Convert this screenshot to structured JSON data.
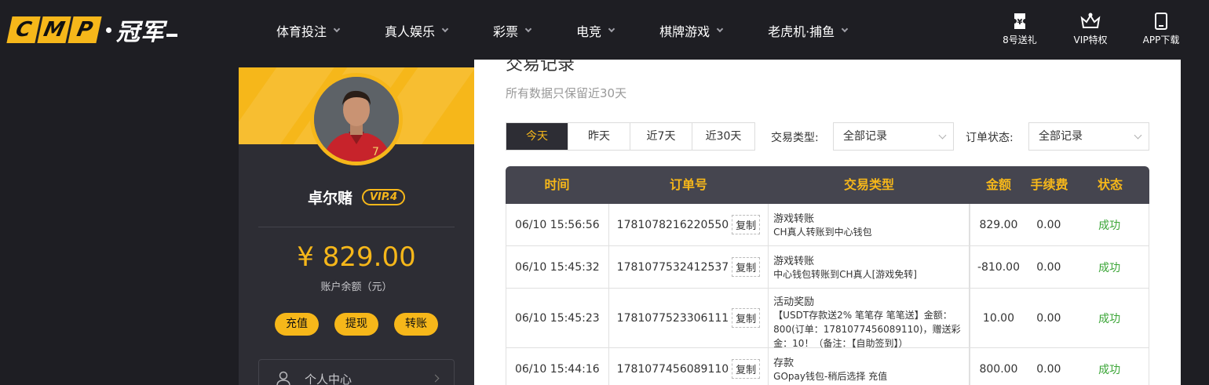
{
  "header": {
    "logo_letters": [
      "C",
      "M",
      "P"
    ],
    "logo_cn": "冠军",
    "nav": [
      {
        "label": "体育投注"
      },
      {
        "label": "真人娱乐"
      },
      {
        "label": "彩票"
      },
      {
        "label": "电竞"
      },
      {
        "label": "棋牌游戏"
      },
      {
        "label": "老虎机·捕鱼"
      }
    ],
    "tools": [
      {
        "label": "8号送礼",
        "icon": "gift-ticket-icon"
      },
      {
        "label": "VIP特权",
        "icon": "crown-icon"
      },
      {
        "label": "APP下载",
        "icon": "phone-icon"
      }
    ]
  },
  "sidebar": {
    "username": "卓尔赌",
    "vip": "VIP.4",
    "balance": "¥ 829.00",
    "balance_label": "账户余额（元）",
    "actions": [
      "充值",
      "提现",
      "转账"
    ],
    "menu": [
      {
        "label": "个人中心"
      }
    ]
  },
  "main": {
    "title": "交易记录",
    "note": "所有数据只保留近30天",
    "ranges": [
      "今天",
      "昨天",
      "近7天",
      "近30天"
    ],
    "active_range": "今天",
    "filters": {
      "type_label": "交易类型:",
      "type_value": "全部记录",
      "status_label": "订单状态:",
      "status_value": "全部记录"
    },
    "table": {
      "headers": [
        "时间",
        "订单号",
        "交易类型",
        "金额",
        "手续费",
        "状态"
      ],
      "copy_label": "复制",
      "rows": [
        {
          "time": "06/10 15:56:56",
          "order": "1781078216220550",
          "type": "游戏转账",
          "detail": "CH真人转账到中心钱包",
          "amount": "829.00",
          "fee": "0.00",
          "status": "成功"
        },
        {
          "time": "06/10 15:45:32",
          "order": "1781077532412537",
          "type": "游戏转账",
          "detail": "中心钱包转账到CH真人[游戏免转]",
          "amount": "-810.00",
          "fee": "0.00",
          "status": "成功"
        },
        {
          "time": "06/10 15:45:23",
          "order": "1781077523306111",
          "type": "活动奖励",
          "detail": "【USDT存款送2% 笔笔存 笔笔送】金额：800(订单：1781077456089110)，赠送彩金：10！（备注：【自助签到】）",
          "amount": "10.00",
          "fee": "0.00",
          "status": "成功"
        },
        {
          "time": "06/10 15:44:16",
          "order": "1781077456089110",
          "type": "存款",
          "detail": "GOpay钱包-稍后选择 充值",
          "amount": "800.00",
          "fee": "0.00",
          "status": "成功"
        }
      ]
    }
  },
  "colors": {
    "accent": "#f6b71a",
    "dark": "#1e1e23",
    "panel": "#2d2d34",
    "success": "#3aa536"
  }
}
